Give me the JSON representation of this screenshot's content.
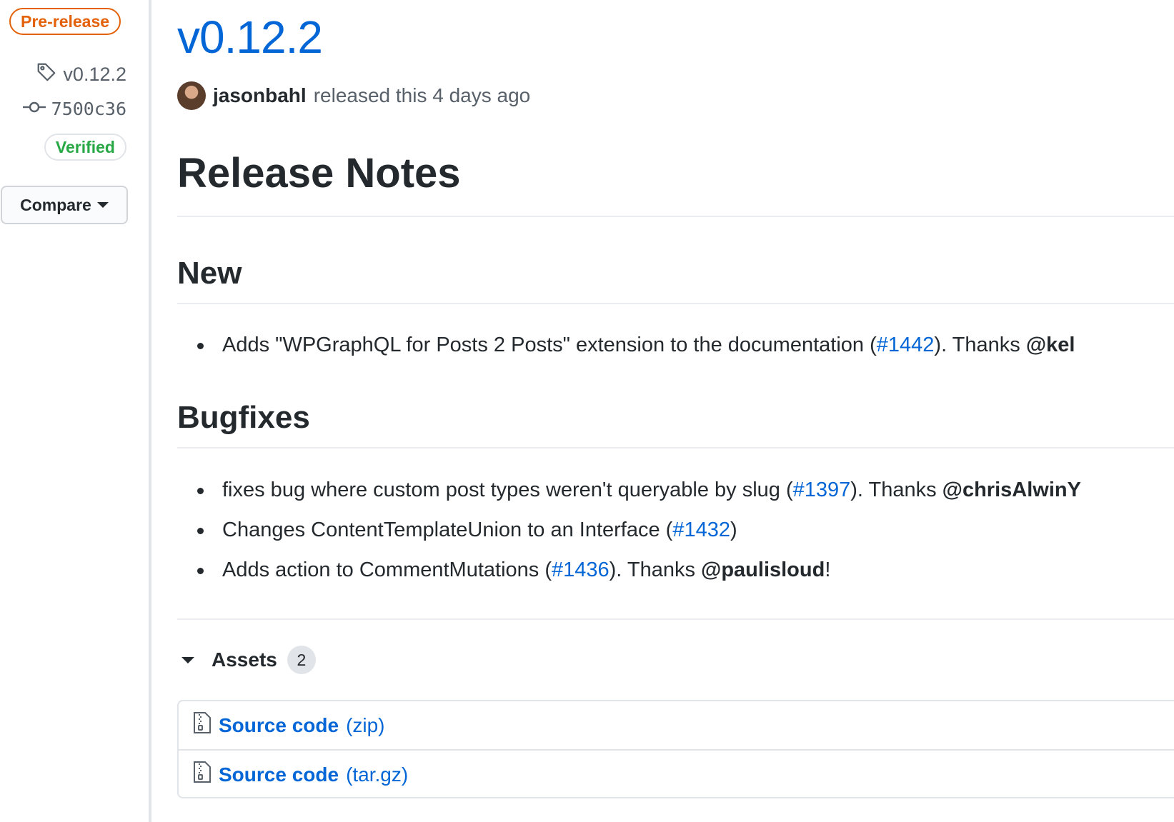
{
  "sidebar": {
    "prerelease_badge": "Pre-release",
    "tag": "v0.12.2",
    "commit": "7500c36",
    "verified_badge": "Verified",
    "compare_label": "Compare"
  },
  "release": {
    "title": "v0.12.2",
    "author": "jasonbahl",
    "released_text": "released this 4 days ago"
  },
  "notes": {
    "heading": "Release Notes",
    "new": {
      "heading": "New",
      "items": [
        {
          "text_before": "Adds \"WPGraphQL for Posts 2 Posts\" extension to the documentation (",
          "link": "#1442",
          "text_after": "). Thanks ",
          "mention": "@kel"
        }
      ]
    },
    "bugfixes": {
      "heading": "Bugfixes",
      "items": [
        {
          "text_before": "fixes bug where custom post types weren't queryable by slug (",
          "link": "#1397",
          "text_after": "). Thanks ",
          "mention": "@chrisAlwinY"
        },
        {
          "text_before": "Changes ContentTemplateUnion to an Interface (",
          "link": "#1432",
          "text_after": ")"
        },
        {
          "text_before": "Adds action to CommentMutations (",
          "link": "#1436",
          "text_after": "). Thanks ",
          "mention": "@paulisloud",
          "text_end": "!"
        }
      ]
    }
  },
  "assets": {
    "label": "Assets",
    "count": "2",
    "items": [
      {
        "name": "Source code",
        "ext": "(zip)"
      },
      {
        "name": "Source code",
        "ext": "(tar.gz)"
      }
    ]
  },
  "icons": {
    "tag": "tag-icon",
    "commit": "commit-icon",
    "archive": "file-zip-icon",
    "caret": "triangle-down-icon"
  },
  "colors": {
    "link": "#0366d6",
    "prerelease": "#e36209",
    "verified": "#28a745"
  }
}
